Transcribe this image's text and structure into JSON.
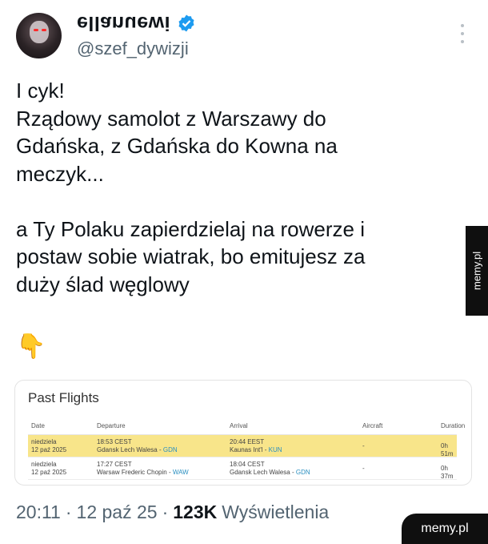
{
  "author": {
    "display_name": "ellanuewi",
    "handle": "@szef_dywizji",
    "verified_color": "#1d9bf0"
  },
  "tweet": {
    "text": "I cyk!\nRządowy samolot z Warszawy do\nGdańska, z Gdańska do Kowna na\nmeczyk...\n\na Ty Polaku zapierdzielaj na rowerze i\npostaw sobie wiatrak, bo emitujesz za\nduży ślad węglowy",
    "emoji": "👇"
  },
  "flights_card": {
    "title": "Past Flights",
    "headers": [
      "Date",
      "Departure",
      "Arrival",
      "Aircraft",
      "Duration"
    ],
    "rows": [
      {
        "date_day": "niedziela",
        "date": "12 paź 2025",
        "dep_time": "18:53 CEST",
        "dep_airport": "Gdansk Lech Walesa - ",
        "dep_code": "GDN",
        "arr_time": "20:44 EEST",
        "arr_airport": "Kaunas Int'l - ",
        "arr_code": "KUN",
        "aircraft": "-",
        "duration": "0h 51m",
        "highlight": true
      },
      {
        "date_day": "niedziela",
        "date": "12 paź 2025",
        "dep_time": "17:27 CEST",
        "dep_airport": "Warsaw Frederic Chopin - ",
        "dep_code": "WAW",
        "arr_time": "18:04 CEST",
        "arr_airport": "Gdansk Lech Walesa - ",
        "arr_code": "GDN",
        "aircraft": "-",
        "duration": "0h 37m",
        "highlight": false
      }
    ],
    "highlight_color": "#f8e58a"
  },
  "footer": {
    "time": "20:11",
    "sep1": "·",
    "date": "12 paź 25",
    "sep2": "·",
    "views_count": "123K",
    "views_label": "Wyświetlenia"
  },
  "watermarks": {
    "side": "memy.pl",
    "corner": "memy.pl"
  }
}
